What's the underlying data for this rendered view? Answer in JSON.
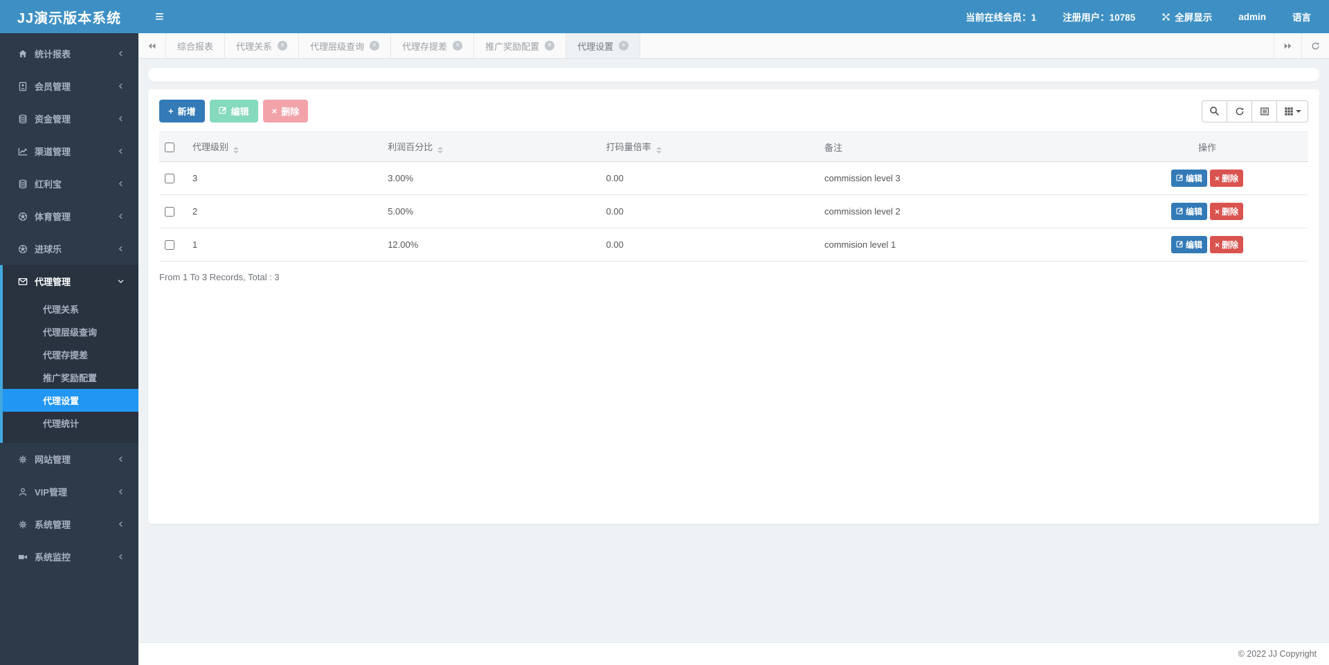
{
  "app": {
    "brand": "JJ演示版本系统",
    "copyright": "© 2022 JJ Copyright"
  },
  "topbar": {
    "online": "当前在线会员：1",
    "registered": "注册用户：10785",
    "fullscreen_label": "全屏显示",
    "user": "admin",
    "language_label": "语言"
  },
  "sidebar": {
    "items": [
      {
        "label": "统计报表",
        "icon": "home-icon"
      },
      {
        "label": "会员管理",
        "icon": "address-book-icon"
      },
      {
        "label": "资金管理",
        "icon": "database-icon"
      },
      {
        "label": "渠道管理",
        "icon": "line-chart-icon"
      },
      {
        "label": "红利宝",
        "icon": "database-icon"
      },
      {
        "label": "体育管理",
        "icon": "soccer-ball-icon"
      },
      {
        "label": "进球乐",
        "icon": "soccer-ball-icon"
      },
      {
        "label": "代理管理",
        "icon": "envelope-icon",
        "expanded": true,
        "children": [
          "代理关系",
          "代理层级查询",
          "代理存提差",
          "推广奖励配置",
          "代理设置",
          "代理统计"
        ],
        "active_child": "代理设置"
      },
      {
        "label": "网站管理",
        "icon": "gears-icon"
      },
      {
        "label": "VIP管理",
        "icon": "user-icon"
      },
      {
        "label": "系统管理",
        "icon": "gear-icon"
      },
      {
        "label": "系统监控",
        "icon": "video-camera-icon"
      }
    ]
  },
  "tabs": {
    "items": [
      {
        "label": "综合报表",
        "closable": false,
        "active": false
      },
      {
        "label": "代理关系",
        "closable": true,
        "active": false
      },
      {
        "label": "代理层级查询",
        "closable": true,
        "active": false
      },
      {
        "label": "代理存提差",
        "closable": true,
        "active": false
      },
      {
        "label": "推广奖励配置",
        "closable": true,
        "active": false
      },
      {
        "label": "代理设置",
        "closable": true,
        "active": true
      }
    ]
  },
  "toolbar": {
    "add_label": "新增",
    "edit_label": "编辑",
    "delete_label": "删除",
    "icon_buttons": [
      "search-icon",
      "refresh-icon",
      "toggle-view-icon",
      "columns-grid-icon"
    ]
  },
  "table": {
    "columns": [
      "代理级别",
      "利润百分比",
      "打码量倍率",
      "备注",
      "操作"
    ],
    "sortable_columns": [
      "代理级别",
      "利润百分比",
      "打码量倍率"
    ],
    "rows": [
      {
        "level": "3",
        "profit": "3.00%",
        "rate": "0.00",
        "remark": "commission level 3"
      },
      {
        "level": "2",
        "profit": "5.00%",
        "rate": "0.00",
        "remark": "commission level 2"
      },
      {
        "level": "1",
        "profit": "12.00%",
        "rate": "0.00",
        "remark": "commision level 1"
      }
    ],
    "row_edit_label": "编辑",
    "row_delete_label": "删除",
    "summary": "From 1 To 3 Records, Total : 3"
  },
  "colors": {
    "navbar_blue": "#3e90c4",
    "sidebar_dark": "#2d3a49",
    "active_menu_blue": "#2196f3",
    "primary_button": "#337ab7",
    "edit_disabled_green": "#85d9bc",
    "delete_disabled_pink": "#f2a3aa",
    "row_delete_red": "#d9534f"
  }
}
